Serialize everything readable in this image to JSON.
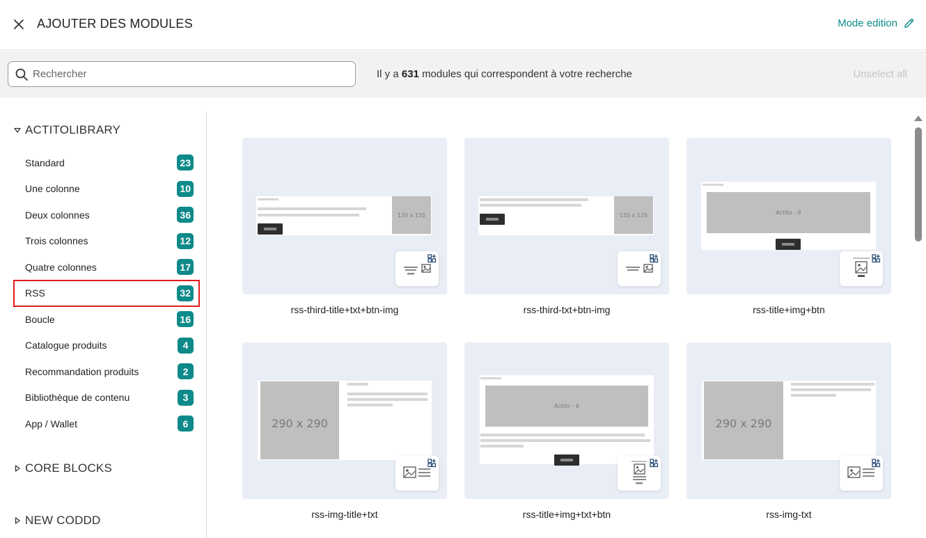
{
  "header": {
    "title": "AJOUTER DES MODULES",
    "mode_edit_label": "Mode edition"
  },
  "search": {
    "placeholder": "Rechercher",
    "result_prefix": "Il y a",
    "result_count": "631",
    "result_suffix": "modules qui correspondent à votre recherche",
    "unselect_label": "Unselect all"
  },
  "sidebar": {
    "groups": [
      {
        "label": "ACTITOLIBRARY",
        "expanded": true
      },
      {
        "label": "CORE BLOCKS",
        "expanded": false
      },
      {
        "label": "NEW CODDD",
        "expanded": false
      }
    ],
    "categories": [
      {
        "label": "Standard",
        "count": "23"
      },
      {
        "label": "Une colonne",
        "count": "10"
      },
      {
        "label": "Deux colonnes",
        "count": "36"
      },
      {
        "label": "Trois colonnes",
        "count": "12"
      },
      {
        "label": "Quatre colonnes",
        "count": "17"
      },
      {
        "label": "RSS",
        "count": "32",
        "selected": true
      },
      {
        "label": "Boucle",
        "count": "16"
      },
      {
        "label": "Catalogue produits",
        "count": "4"
      },
      {
        "label": "Recommandation produits",
        "count": "2"
      },
      {
        "label": "Bibliothèque de contenu",
        "count": "3"
      },
      {
        "label": "App / Wallet",
        "count": "6"
      }
    ]
  },
  "modules": [
    {
      "name": "rss-third-title+txt+btn-img",
      "image_label": "135 x 135"
    },
    {
      "name": "rss-third-txt+btn-img",
      "image_label": "135 x 135"
    },
    {
      "name": "rss-title+img+btn",
      "image_label": "Actito - 6"
    },
    {
      "name": "rss-img-title+txt",
      "image_label": "290 x 290"
    },
    {
      "name": "rss-title+img+txt+btn",
      "image_label": "Actito - 6"
    },
    {
      "name": "rss-img-txt",
      "image_label": "290 x 290"
    }
  ],
  "colors": {
    "accent": "#0e8a8a",
    "selected_outline": "#e31b1b",
    "thumb_bg": "#e9edf5",
    "search_bar_bg": "#f2f2f2"
  },
  "icons": {
    "close": "close-icon",
    "edit": "pencil-icon",
    "search": "search-icon",
    "expand": "triangle-icon",
    "add_module": "add-grid-icon"
  }
}
